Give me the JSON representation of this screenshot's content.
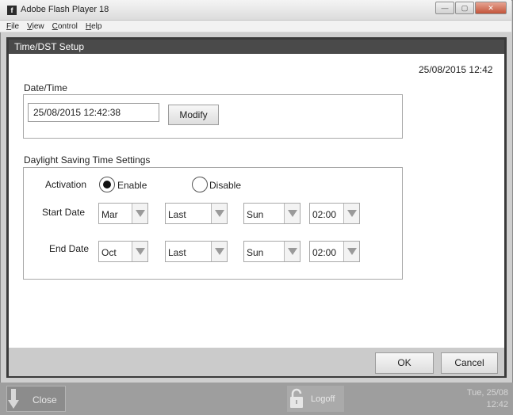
{
  "window": {
    "title": "Adobe Flash Player 18",
    "menu": [
      "File",
      "View",
      "Control",
      "Help"
    ],
    "menu_underline": [
      "F",
      "V",
      "C",
      "H"
    ],
    "menu_rest": [
      "ile",
      "iew",
      "ontrol",
      "elp"
    ]
  },
  "dialog": {
    "title": "Time/DST Setup",
    "current_datetime": "25/08/2015 12:42",
    "date_time": {
      "section_label": "Date/Time",
      "value": "25/08/2015 12:42:38",
      "modify_label": "Modify"
    },
    "dst": {
      "section_label": "Daylight Saving Time Settings",
      "activation_label": "Activation",
      "enable_label": "Enable",
      "disable_label": "Disable",
      "activation_selected": "Enable",
      "start_label": "Start Date",
      "start": {
        "month": "Mar",
        "week": "Last",
        "day": "Sun",
        "time": "02:00"
      },
      "end_label": "End Date",
      "end": {
        "month": "Oct",
        "week": "Last",
        "day": "Sun",
        "time": "02:00"
      }
    },
    "ok_label": "OK",
    "cancel_label": "Cancel"
  },
  "taskbar": {
    "close_label": "Close",
    "logoff_label": "Logoff",
    "date": "Tue, 25/08",
    "time": "12:42"
  },
  "colors": {
    "dialog_header": "#4a4a4a",
    "footer": "#cbcbcb",
    "taskbar": "#9e9e9e"
  }
}
